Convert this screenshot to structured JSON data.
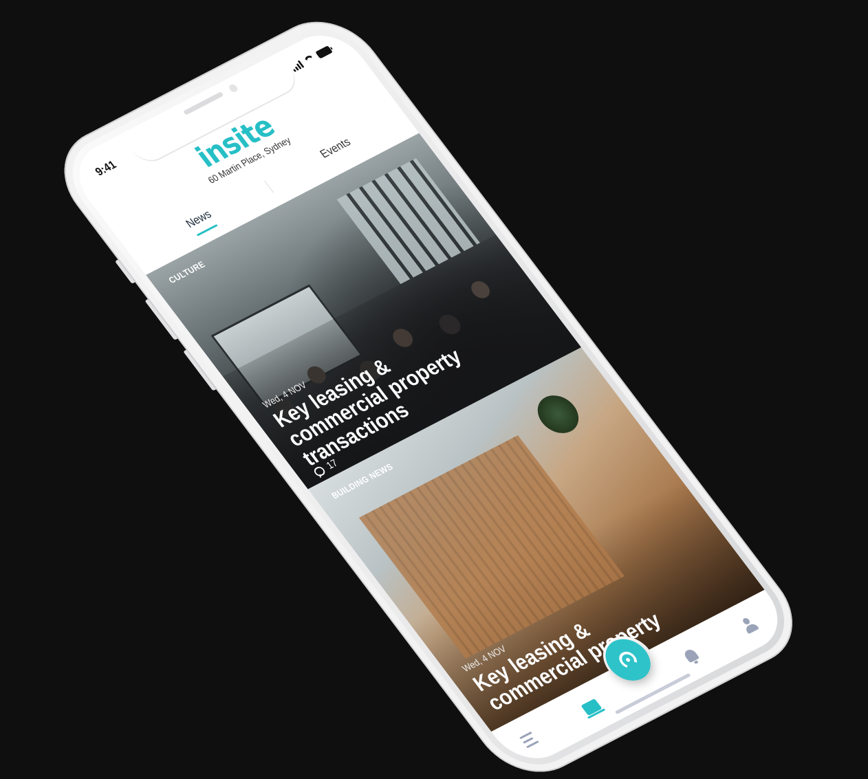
{
  "status_bar": {
    "time": "9:41"
  },
  "header": {
    "logo": "insite",
    "location": "60 Martin Place, Sydney"
  },
  "tabs": [
    {
      "label": "News",
      "active": true
    },
    {
      "label": "Events",
      "active": false
    }
  ],
  "cards": [
    {
      "category": "CULTURE",
      "date": "Wed, 4 NOV",
      "headline": "Key leasing & commercial property transactions",
      "comments": "17"
    },
    {
      "category": "BUILDING NEWS",
      "date": "Wed, 4 NOV",
      "headline": "Key leasing & commercial property"
    }
  ],
  "bottom_nav": {
    "items": [
      {
        "icon": "menu-icon"
      },
      {
        "icon": "home-icon",
        "active": true
      },
      {
        "icon": "beacon-icon"
      },
      {
        "icon": "bell-icon"
      },
      {
        "icon": "profile-icon"
      }
    ]
  },
  "colors": {
    "accent": "#27bfc6",
    "nav_inactive": "#9aa3b8",
    "background": "#0f0f10"
  }
}
